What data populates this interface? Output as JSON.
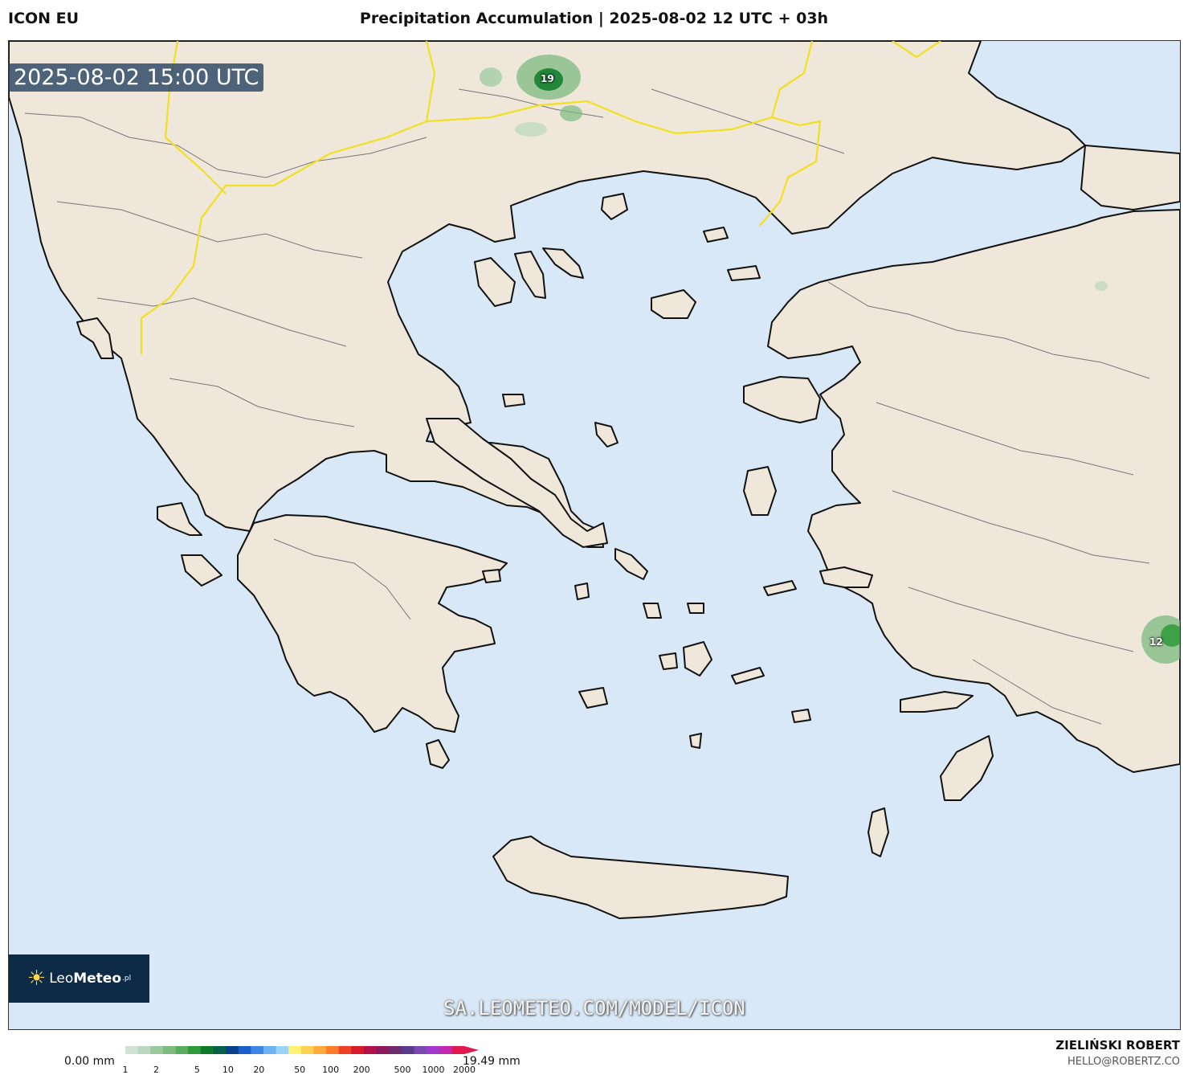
{
  "header": {
    "model": "ICON EU",
    "title": "Precipitation Accumulation | 2025-08-02 12 UTC + 03h"
  },
  "map": {
    "valid_time": "2025-08-02 15:00 UTC",
    "watermark": "SA.LEOMETEO.COM/MODEL/ICON",
    "colors": {
      "sea": "#d9e8f6",
      "land": "#efe7da",
      "coast": "#111111",
      "border": "#f0e020",
      "rivers": "#bcd0e0"
    },
    "cell_labels": [
      {
        "label": "19",
        "place": "northern Bulgaria / Greece border area"
      },
      {
        "label": "12",
        "place": "southwest Turkey, east edge"
      }
    ]
  },
  "logo": {
    "sun_icon": "☀",
    "text_light": "Leo",
    "text_bold": "Meteo",
    "suffix": ".pl"
  },
  "legend": {
    "min_label": "0.00 mm",
    "max_label": "19.49 mm",
    "ticks": [
      "1",
      "2",
      "5",
      "10",
      "20",
      "50",
      "100",
      "200",
      "500",
      "1000",
      "2000"
    ],
    "colors": [
      "#cfe3d2",
      "#b9d8bd",
      "#9bc99e",
      "#7dbb80",
      "#5aac5e",
      "#2e9a3a",
      "#0d7a2a",
      "#08624a",
      "#0a3f8a",
      "#1a5fc8",
      "#3d86e6",
      "#6db2f2",
      "#9ad2f8",
      "#fff275",
      "#ffd052",
      "#ffaa3a",
      "#ff7c2a",
      "#f04028",
      "#d91a2a",
      "#b0124a",
      "#8e1a5e",
      "#6e2c6e",
      "#5a3a8a",
      "#7a4ab0",
      "#a03ad0",
      "#c02ab0",
      "#e01a50"
    ]
  },
  "author": {
    "name": "ZIELIŃSKI ROBERT",
    "email": "HELLO@ROBERTZ.CO"
  }
}
